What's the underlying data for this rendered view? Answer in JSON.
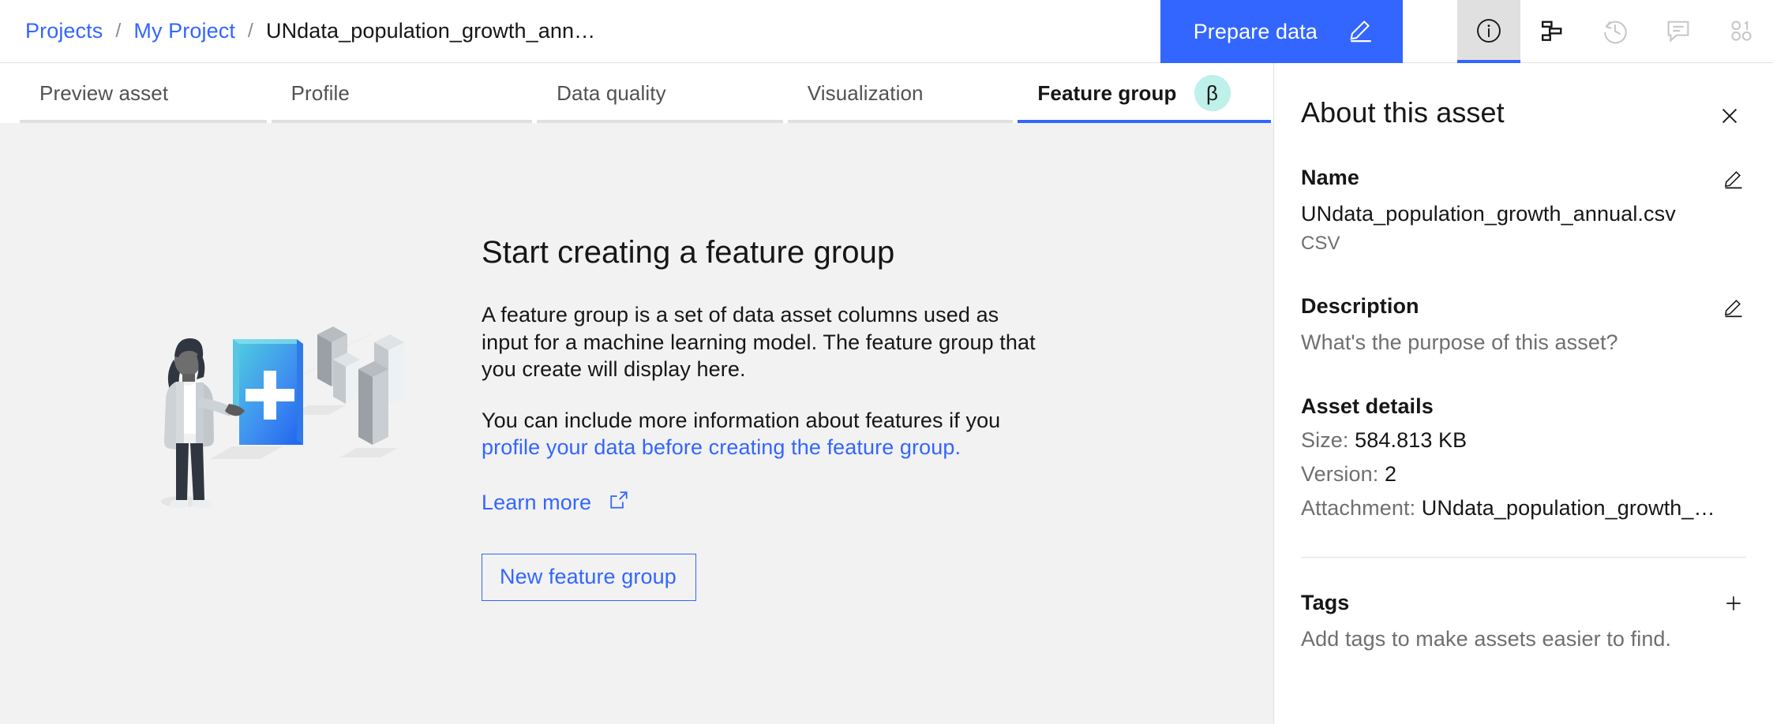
{
  "breadcrumb": {
    "projects": "Projects",
    "separator": "/",
    "project": "My Project",
    "current": "UNdata_population_growth_ann…"
  },
  "topbar": {
    "prepare_data_label": "Prepare data",
    "icons": {
      "pencil": "pencil-icon",
      "info": "information-icon",
      "lineage": "lineage-icon",
      "history": "history-icon",
      "comment": "comment-icon",
      "binary": "binary-data-icon"
    },
    "accent_color": "#3366ff",
    "active_icon_bg": "#e0e0e0"
  },
  "tabs": [
    {
      "label": "Preview asset",
      "active": false
    },
    {
      "label": "Profile",
      "active": false
    },
    {
      "label": "Data quality",
      "active": false
    },
    {
      "label": "Visualization",
      "active": false
    },
    {
      "label": "Feature group",
      "active": true,
      "badge": "β",
      "badge_color": "#bdf1ea"
    }
  ],
  "empty_state": {
    "heading": "Start creating a feature group",
    "paragraph1": "A feature group is a set of data asset columns used as input for a machine learning model. The feature group that you create will display here.",
    "paragraph2_prefix": "You can include more information about features if you ",
    "paragraph2_link": "profile your data before creating the feature group.",
    "learn_more": "Learn more",
    "learn_more_icon": "external-link-icon",
    "new_feature_group_button": "New feature group",
    "illustration": "person-adding-feature-group-illustration",
    "background": "#f2f2f2"
  },
  "about_panel": {
    "title": "About this asset",
    "close_icon": "close-icon",
    "name": {
      "label": "Name",
      "value": "UNdata_population_growth_annual.csv",
      "format": "CSV",
      "edit_icon": "pencil-icon"
    },
    "description": {
      "label": "Description",
      "placeholder": "What's the purpose of this asset?",
      "edit_icon": "pencil-icon"
    },
    "asset_details": {
      "label": "Asset details",
      "rows": [
        {
          "key": "Size:",
          "value": "584.813 KB"
        },
        {
          "key": "Version:",
          "value": "2"
        },
        {
          "key": "Attachment:",
          "value": "UNdata_population_growth_…"
        }
      ]
    },
    "tags": {
      "label": "Tags",
      "add_icon": "plus-icon",
      "empty_text": "Add tags to make assets easier to find."
    }
  }
}
